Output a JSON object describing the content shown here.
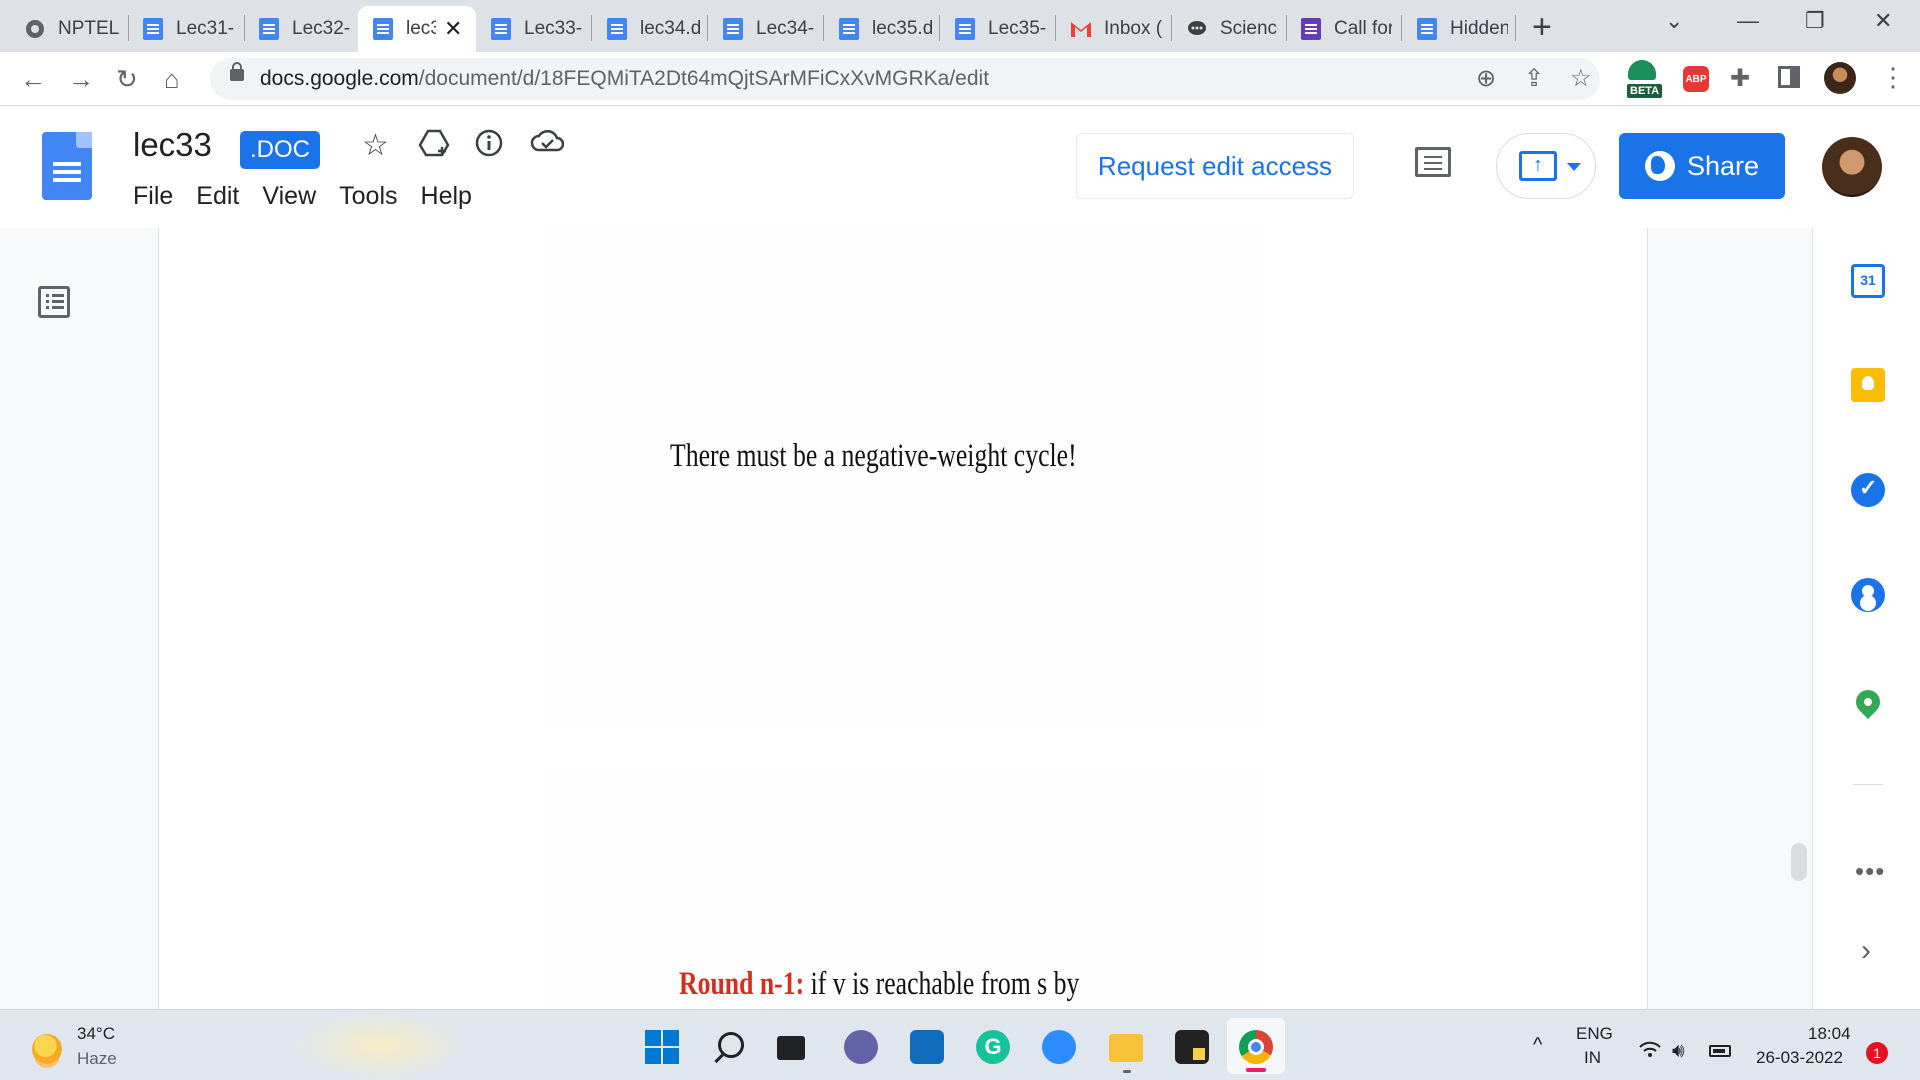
{
  "browser": {
    "tabs": [
      {
        "title": "NPTEL",
        "favicon": "globe-icon"
      },
      {
        "title": "Lec31-",
        "favicon": "docs-icon"
      },
      {
        "title": "Lec32-",
        "favicon": "docs-icon"
      },
      {
        "title": "lec3",
        "favicon": "docs-icon",
        "active": true
      },
      {
        "title": "Lec33-",
        "favicon": "docs-icon"
      },
      {
        "title": "lec34.d",
        "favicon": "docs-icon"
      },
      {
        "title": "Lec34-",
        "favicon": "docs-icon"
      },
      {
        "title": "lec35.d",
        "favicon": "docs-icon"
      },
      {
        "title": "Lec35-",
        "favicon": "docs-icon"
      },
      {
        "title": "Inbox (",
        "favicon": "gmail-icon"
      },
      {
        "title": "Science",
        "favicon": "chat-icon"
      },
      {
        "title": "Call for",
        "favicon": "forms-icon"
      },
      {
        "title": "Hidden",
        "favicon": "docs-icon"
      }
    ],
    "url_domain": "docs.google.com",
    "url_path": "/document/d/18FEQMiTA2Dt64mQjtSArMFiCxXvMGRKa/edit",
    "extension_badge": "BETA",
    "adblock_label": "ABP"
  },
  "docs": {
    "title": "lec33",
    "badge": ".DOC",
    "menu": [
      "File",
      "Edit",
      "View",
      "Tools",
      "Help"
    ],
    "request_edit_label": "Request edit access",
    "share_label": "Share",
    "accent": "#1a73e8"
  },
  "content": {
    "slide1_text": "There must be a negative-weight cycle!",
    "slide2_bold": "Round n-1:",
    "slide2_text": " if v is reachable from s by",
    "highlight_color": "#d32f1f"
  },
  "sidepanel": {
    "calendar_day": "31",
    "more_label": "•••",
    "expand_label": "›"
  },
  "taskbar": {
    "temperature": "34°C",
    "weather": "Haze",
    "language_top": "ENG",
    "language_bottom": "IN",
    "time": "18:04",
    "date": "26-03-2022",
    "notifications": "1"
  }
}
